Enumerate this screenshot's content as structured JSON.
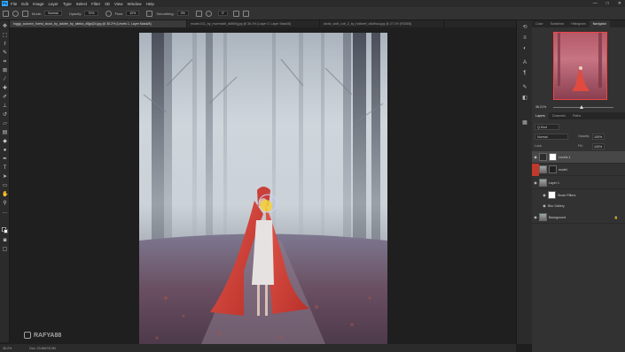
{
  "menubar": {
    "app_icon": "Ps",
    "items": [
      "File",
      "Edit",
      "Image",
      "Layer",
      "Type",
      "Select",
      "Filter",
      "3D",
      "View",
      "Window",
      "Help"
    ],
    "window_controls": [
      "—",
      "□",
      "✕"
    ]
  },
  "options": {
    "mode_label": "Mode:",
    "mode_value": "Normal",
    "opacity_label": "Opacity:",
    "opacity_value": "70%",
    "flow_label": "Flow:",
    "flow_value": "10%",
    "smoothing_label": "Smoothing:",
    "smoothing_value": "0%",
    "angle_value": "0°"
  },
  "tabs": [
    {
      "label": "foggy_autumn_forest_stock_by_adobe_by_aiteka_d5jpij34.jpg @ 36.2% (Levels 1, Layer Mask/8)",
      "active": true
    },
    {
      "label": "model-011_by_morenkell_d6f6i9j.jpg @ 36.4% (Layer 0, Layer Mask/8)",
      "active": false
    },
    {
      "label": "arctic_wolf_cub_2_by_hotbeef_d4cfbua.jpg @ 27.1% (RGB/8)",
      "active": false
    }
  ],
  "toolbar": {
    "tools": [
      "move-icon",
      "marquee-icon",
      "lasso-icon",
      "quick-select-icon",
      "crop-icon",
      "frame-icon",
      "eyedropper-icon",
      "healing-icon",
      "brush-icon",
      "stamp-icon",
      "history-brush-icon",
      "eraser-icon",
      "gradient-icon",
      "blur-icon",
      "dodge-icon",
      "pen-icon",
      "type-icon",
      "path-select-icon",
      "rectangle-icon",
      "hand-icon",
      "zoom-icon",
      "more-icon"
    ]
  },
  "canvas": {
    "watermark_text": "RAFYA88",
    "fg_color": "#000000",
    "bg_color": "#ffffff"
  },
  "status": {
    "zoom": "36.2%",
    "doc_size": "Doc: 23.8M/78.3M"
  },
  "panels": {
    "top_tabs": [
      "Color",
      "Swatches",
      "Histogram",
      "Navigator"
    ],
    "navigator_zoom": "36.21%",
    "layers_tabs": [
      "Layers",
      "Channels",
      "Paths"
    ],
    "kind_label": "Q Kind",
    "blend_mode": "Normal",
    "opacity_label": "Opacity:",
    "opacity_value": "100%",
    "lock_label": "Lock:",
    "fill_label": "Fill:",
    "fill_value": "100%",
    "layers": [
      {
        "name": "Levels 1",
        "thumb": "adj",
        "selected": true
      },
      {
        "name": "model",
        "thumb": "img",
        "selected": false
      },
      {
        "name": "Layer 1",
        "thumb": "img",
        "selected": false
      },
      {
        "name": "Background",
        "thumb": "img",
        "selected": false
      }
    ],
    "sub_rows": [
      "Smart Filters",
      "Blur Gallery"
    ]
  },
  "accent_colors": {
    "ps_blue": "#31a8ff",
    "cape_red": "#d7443a",
    "selection_red": "#c0392b"
  }
}
